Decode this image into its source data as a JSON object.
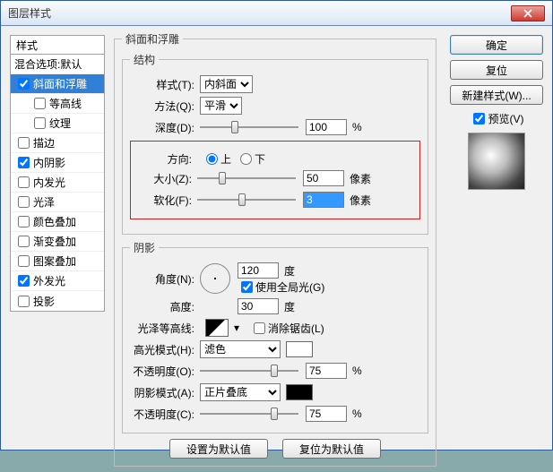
{
  "window": {
    "title": "图层样式"
  },
  "buttons": {
    "ok": "确定",
    "cancel": "复位",
    "newStyle": "新建样式(W)...",
    "preview": "预览(V)",
    "setDefault": "设置为默认值",
    "resetDefault": "复位为默认值",
    "close": "×"
  },
  "stylesHeader": "样式",
  "styles": [
    {
      "label": "混合选项:默认",
      "checked": false,
      "nochk": true
    },
    {
      "label": "斜面和浮雕",
      "checked": true,
      "sel": true
    },
    {
      "label": "等高线",
      "checked": false,
      "indent": true
    },
    {
      "label": "纹理",
      "checked": false,
      "indent": true
    },
    {
      "label": "描边",
      "checked": false
    },
    {
      "label": "内阴影",
      "checked": true
    },
    {
      "label": "内发光",
      "checked": false
    },
    {
      "label": "光泽",
      "checked": false
    },
    {
      "label": "颜色叠加",
      "checked": false
    },
    {
      "label": "渐变叠加",
      "checked": false
    },
    {
      "label": "图案叠加",
      "checked": false
    },
    {
      "label": "外发光",
      "checked": true
    },
    {
      "label": "投影",
      "checked": false
    }
  ],
  "bevel": {
    "groupTitle": "斜面和浮雕",
    "structTitle": "结构",
    "styleLabel": "样式(T):",
    "styleValue": "内斜面",
    "techLabel": "方法(Q):",
    "techValue": "平滑",
    "depthLabel": "深度(D):",
    "depthValue": "100",
    "depthUnit": "%",
    "dirLabel": "方向:",
    "dirUp": "上",
    "dirDown": "下",
    "sizeLabel": "大小(Z):",
    "sizeValue": "50",
    "sizeUnit": "像素",
    "softenLabel": "软化(F):",
    "softenValue": "3",
    "softenUnit": "像素"
  },
  "shade": {
    "title": "阴影",
    "angleLabel": "角度(N):",
    "angleValue": "120",
    "angleUnit": "度",
    "globalLight": "使用全局光(G)",
    "altLabel": "高度:",
    "altValue": "30",
    "altUnit": "度",
    "glossLabel": "光泽等高线:",
    "antiAlias": "消除锯齿(L)",
    "hiModeLabel": "高光模式(H):",
    "hiModeValue": "滤色",
    "hiColor": "#ffffff",
    "hiOpLabel": "不透明度(O):",
    "hiOpValue": "75",
    "hiOpUnit": "%",
    "shModeLabel": "阴影模式(A):",
    "shModeValue": "正片叠底",
    "shColor": "#000000",
    "shOpLabel": "不透明度(C):",
    "shOpValue": "75",
    "shOpUnit": "%"
  }
}
